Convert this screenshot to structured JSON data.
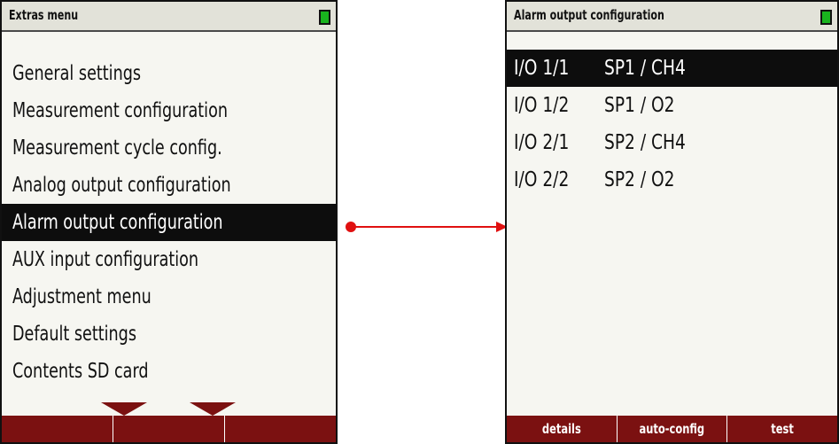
{
  "left": {
    "title": "Extras menu",
    "items": [
      {
        "label": "General settings"
      },
      {
        "label": "Measurement configuration"
      },
      {
        "label": "Measurement cycle config."
      },
      {
        "label": "Analog output configuration"
      },
      {
        "label": "Alarm output configuration",
        "selected": true
      },
      {
        "label": "AUX input configuration"
      },
      {
        "label": "Adjustment menu"
      },
      {
        "label": "Default settings"
      },
      {
        "label": "Contents SD card"
      }
    ],
    "softkeys": [
      "",
      "",
      ""
    ]
  },
  "right": {
    "title": "Alarm output configuration",
    "rows": [
      {
        "io": "I/O 1/1",
        "assign": "SP1 / CH4",
        "selected": true
      },
      {
        "io": "I/O 1/2",
        "assign": "SP1 / O2"
      },
      {
        "io": "I/O 2/1",
        "assign": "SP2 / CH4"
      },
      {
        "io": "I/O 2/2",
        "assign": "SP2 / O2"
      }
    ],
    "softkeys": [
      "details",
      "auto-config",
      "test"
    ]
  },
  "colors": {
    "softkey_bar": "#7b1111",
    "battery": "#19b31e",
    "connector": "#e01010",
    "selection": "#0d0d0d"
  }
}
